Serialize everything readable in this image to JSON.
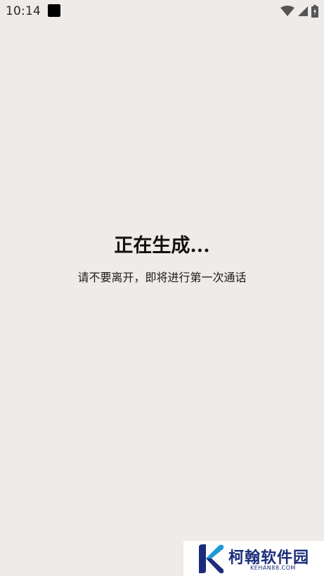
{
  "status_bar": {
    "time": "10:14"
  },
  "main": {
    "title": "正在生成...",
    "subtitle": "请不要离开，即将进行第一次通话"
  },
  "watermark": {
    "name_cn": "柯翰软件园",
    "name_en": "KEHAN88.COM"
  },
  "colors": {
    "background": "#efebe8",
    "watermark_brand": "#1b2d7a"
  }
}
